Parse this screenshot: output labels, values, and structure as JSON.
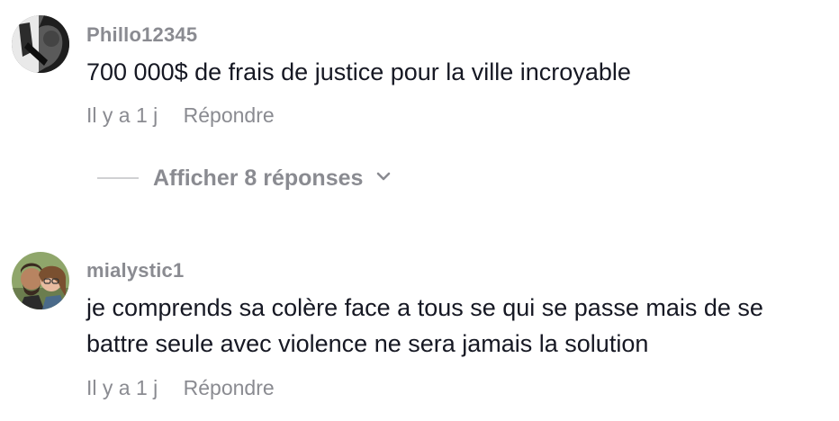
{
  "comments": [
    {
      "username": "Phillo12345",
      "text": "700 000$ de frais de justice pour la ville incroyable",
      "time": "Il y a 1 j",
      "reply_label": "Répondre",
      "avatar_icon": "avatar-photo-icon"
    },
    {
      "username": "mialystic1",
      "text": "je comprends sa colère face a tous se qui se passe mais de se battre seule avec violence ne sera jamais la solution",
      "time": "Il y a 1 j",
      "reply_label": "Répondre",
      "avatar_icon": "avatar-photo-icon"
    }
  ],
  "replies_toggle": {
    "label": "Afficher 8 réponses",
    "icon": "chevron-down-icon"
  },
  "colors": {
    "text": "#161823",
    "muted": "#8a8b91",
    "divider": "#d0d1d3"
  }
}
